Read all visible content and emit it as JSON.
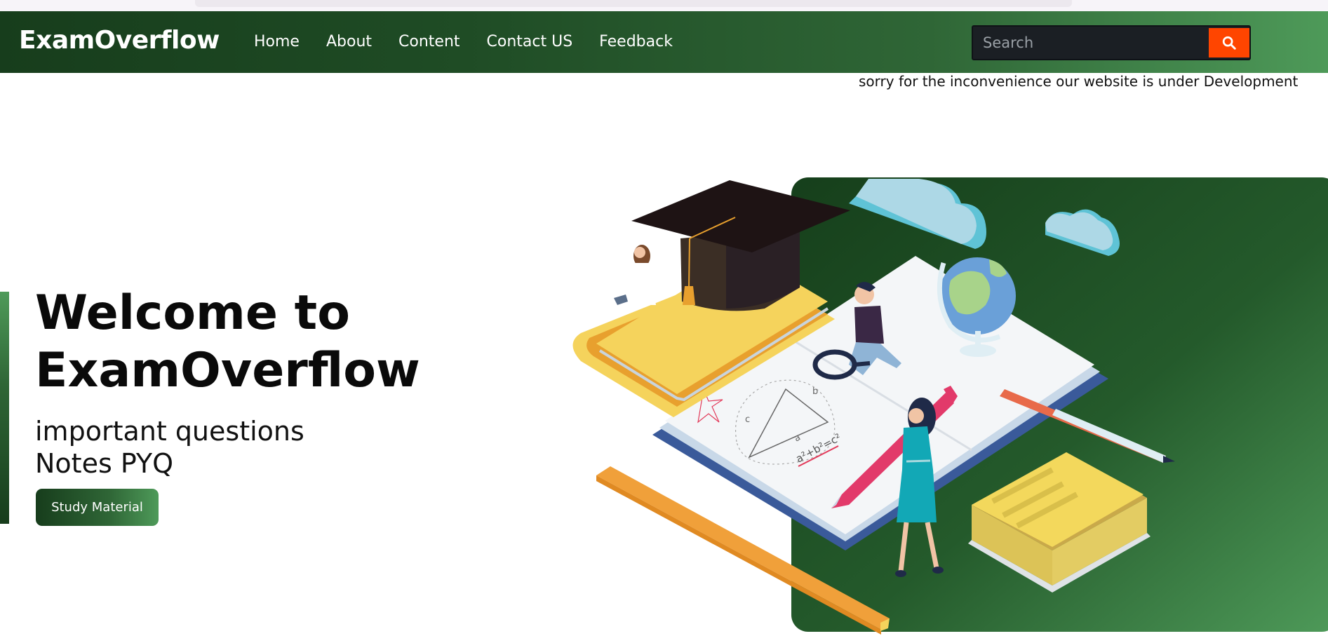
{
  "brand": {
    "name": "ExamOverflow"
  },
  "nav": {
    "links": [
      "Home",
      "About",
      "Content",
      "Contact US",
      "Feedback"
    ]
  },
  "search": {
    "placeholder": "Search",
    "button_icon": "search-icon"
  },
  "notice": "sorry for the inconvenience our website is under Development",
  "hero": {
    "title_line1": "Welcome to",
    "title_line2": "ExamOverflow",
    "subtitle_line1": "important questions",
    "subtitle_line2": "Notes PYQ",
    "button_label": "Study Material"
  },
  "illustration": {
    "formula": "a²+b²=c²",
    "label_a": "a",
    "label_b": "b",
    "label_c": "c"
  },
  "colors": {
    "brand_dark": "#173d1c",
    "brand_light": "#4e9a59",
    "search_button": "#ff4500"
  }
}
